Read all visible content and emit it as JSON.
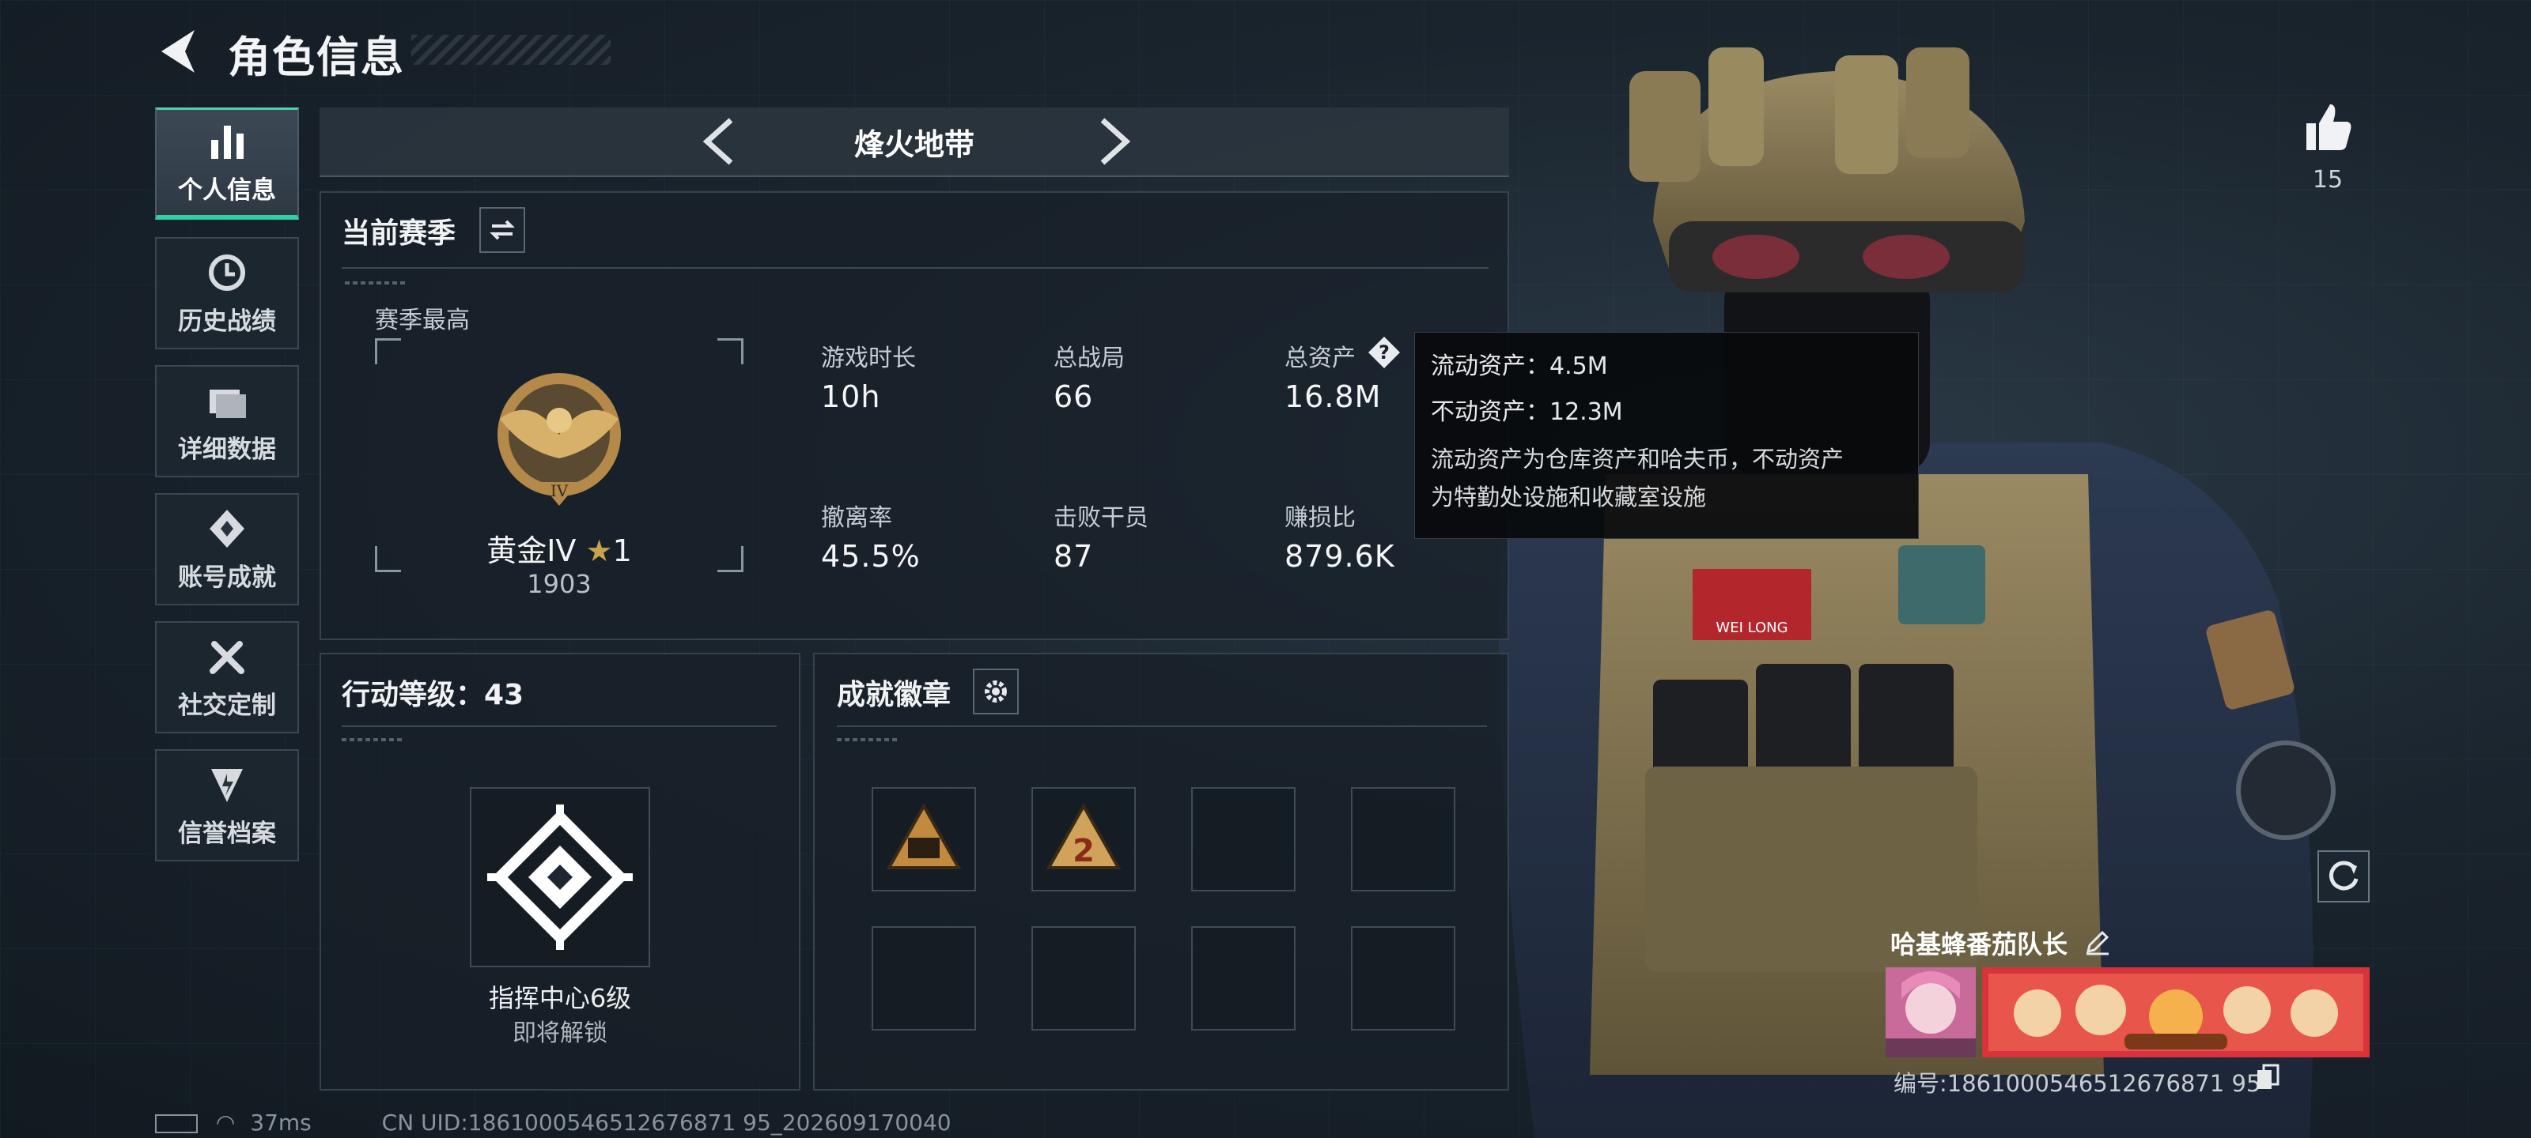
{
  "header": {
    "title": "角色信息"
  },
  "nav": [
    {
      "label": "个人信息",
      "icon": "bar-chart-icon",
      "active": true
    },
    {
      "label": "历史战绩",
      "icon": "history-icon"
    },
    {
      "label": "详细数据",
      "icon": "folder-icon"
    },
    {
      "label": "账号成就",
      "icon": "achievement-icon"
    },
    {
      "label": "社交定制",
      "icon": "tools-icon"
    },
    {
      "label": "信誉档案",
      "icon": "shield-icon"
    }
  ],
  "mode": {
    "title": "烽火地带"
  },
  "season": {
    "title": "当前赛季",
    "best_label": "赛季最高",
    "rank_name": "黄金IV",
    "rank_stars": "1",
    "rank_points": "1903",
    "stats": [
      {
        "label": "游戏时长",
        "value": "10h"
      },
      {
        "label": "总战局",
        "value": "66"
      },
      {
        "label": "总资产",
        "value": "16.8M"
      },
      {
        "label": "撤离率",
        "value": "45.5%"
      },
      {
        "label": "击败干员",
        "value": "87"
      },
      {
        "label": "赚损比",
        "value": "879.6K"
      }
    ]
  },
  "tooltip": {
    "liquid": "流动资产：4.5M",
    "fixed": "不动资产：12.3M",
    "desc1": "流动资产为仓库资产和哈夫币，不动资产",
    "desc2": "为特勤处设施和收藏室设施"
  },
  "level": {
    "title": "行动等级：43",
    "center_name": "指挥中心6级",
    "center_status": "即将解锁"
  },
  "badges": {
    "title": "成就徽章"
  },
  "player": {
    "likes": "15",
    "name": "哈基蜂番茄队长",
    "id": "编号:1861000546512676871 95"
  },
  "status": {
    "ping": "37ms",
    "uid": "CN UID:1861000546512676871 95_202609170040"
  },
  "colors": {
    "accent": "#2fd0a3",
    "gold": "#c9a24e"
  }
}
